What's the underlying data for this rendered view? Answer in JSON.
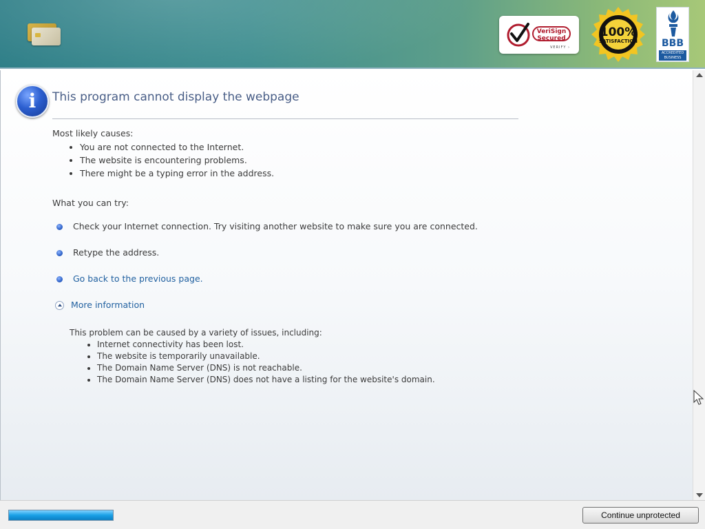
{
  "banner": {
    "verisign": {
      "line1": "VeriSign",
      "line2": "Secured",
      "verify": "VERIFY ›"
    },
    "seal": {
      "big": "100%",
      "small": "SATISFACTION",
      "ring": "GUARANTEED"
    },
    "bbb": {
      "text": "BBB",
      "accredited": "ACCREDITED BUSINESS"
    }
  },
  "page": {
    "title": "This program cannot display the webpage",
    "causes_heading": "Most likely causes:",
    "causes": [
      "You are not connected to the Internet.",
      "The website is encountering problems.",
      "There might be a typing error in the address."
    ],
    "try_heading": "What you can try:",
    "try_items": [
      "Check your Internet connection. Try visiting another website to make sure you are connected.",
      "Retype the address.",
      "Go back to the previous page."
    ],
    "more_info": "More information",
    "details_heading": "This problem can be caused by a variety of issues, including:",
    "details": [
      "Internet connectivity has been lost.",
      "The website is temporarily unavailable.",
      "The Domain Name Server (DNS) is not reachable.",
      "The Domain Name Server (DNS) does not have a listing for the website's domain."
    ]
  },
  "bottom": {
    "continue_label": "Continue unprotected",
    "progress": 1.0
  },
  "icons": {
    "info": "info-icon",
    "bullet": "blue-bullet-icon",
    "collapse": "chevron-up-circle-icon"
  },
  "colors": {
    "title": "#485d86",
    "link": "#1f5f9f",
    "progress": "#1aa0e6"
  }
}
